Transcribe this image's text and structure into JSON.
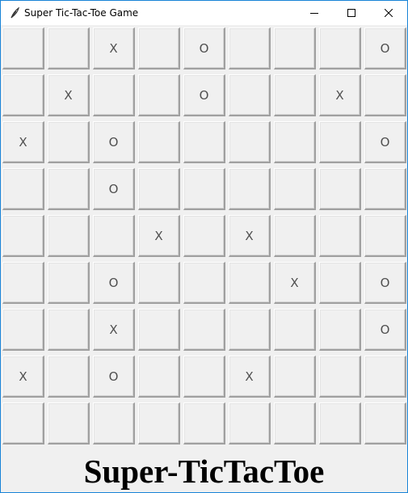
{
  "window": {
    "title": "Super Tic-Tac-Toe Game",
    "controls": [
      "minimize",
      "maximize",
      "close"
    ],
    "accent_border": "#1883d7"
  },
  "board": {
    "rows": 9,
    "cols": 9,
    "cells": [
      [
        "",
        "",
        "X",
        "",
        "O",
        "",
        "",
        "",
        "O"
      ],
      [
        "",
        "X",
        "",
        "",
        "O",
        "",
        "",
        "X",
        ""
      ],
      [
        "X",
        "",
        "O",
        "",
        "",
        "",
        "",
        "",
        "O"
      ],
      [
        "",
        "",
        "O",
        "",
        "",
        "",
        "",
        "",
        ""
      ],
      [
        "",
        "",
        "",
        "X",
        "",
        "X",
        "",
        "",
        ""
      ],
      [
        "",
        "",
        "O",
        "",
        "",
        "",
        "X",
        "",
        "O"
      ],
      [
        "",
        "",
        "X",
        "",
        "",
        "",
        "",
        "",
        "O"
      ],
      [
        "X",
        "",
        "O",
        "",
        "",
        "X",
        "",
        "",
        ""
      ],
      [
        "",
        "",
        "",
        "",
        "",
        "",
        "",
        "",
        ""
      ]
    ]
  },
  "footer": {
    "heading": "Super-TicTacToe"
  },
  "icons": {
    "app": "feather-icon",
    "minimize": "minimize-icon",
    "maximize": "maximize-icon",
    "close": "close-icon"
  }
}
